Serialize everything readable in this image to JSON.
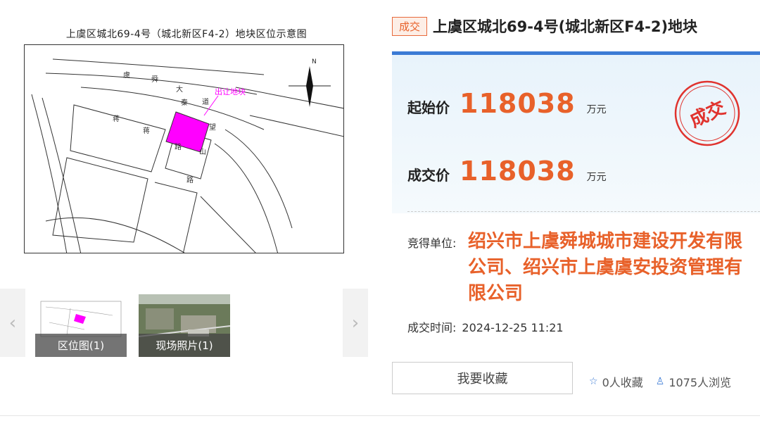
{
  "map": {
    "title": "上虞区城北69-4号（城北新区F4-2）地块区位示意图",
    "labels": {
      "road1": [
        "虞",
        "舜",
        "大",
        "道"
      ],
      "road2": [
        "蒋",
        "秦",
        "望",
        "路"
      ],
      "road3": [
        "蒋",
        "山",
        "路"
      ],
      "marker": "出让地块",
      "north": "N"
    }
  },
  "thumbnails": [
    {
      "label": "区位图(1)"
    },
    {
      "label": "现场照片(1)"
    }
  ],
  "nav": {
    "prev": "‹",
    "next": "›"
  },
  "listing": {
    "badge": "成交",
    "title": "上虞区城北69-4号(城北新区F4-2)地块",
    "start_price_label": "起始价",
    "start_price": "118038",
    "start_price_unit": "万元",
    "deal_price_label": "成交价",
    "deal_price": "118038",
    "deal_price_unit": "万元",
    "stamp_text": "成交",
    "winner_label": "竞得单位:",
    "winner": "绍兴市上虞舜城城市建设开发有限公司、绍兴市上虞虞安投资管理有限公司",
    "time_label": "成交时间:",
    "time_value": "2024-12-25 11:21",
    "fav_button": "我要收藏",
    "fav_count": "0人收藏",
    "view_count": "1075人浏览"
  },
  "colors": {
    "accent": "#e8612a",
    "blue": "#3c7bd5",
    "plot": "#ff00ff"
  }
}
